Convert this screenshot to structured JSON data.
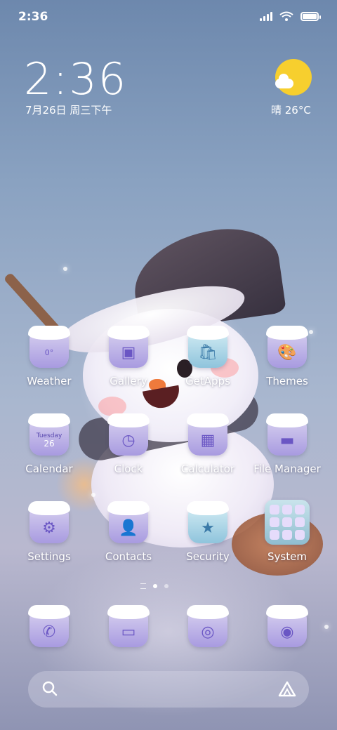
{
  "status_bar": {
    "time": "2:36",
    "icons": [
      "signal-icon",
      "wifi-icon",
      "battery-icon"
    ]
  },
  "clock_widget": {
    "time": "2:36",
    "date": "7月26日 周三下午"
  },
  "weather_widget": {
    "icon": "sunny-cloud-icon",
    "text": "晴 26°C"
  },
  "apps": [
    {
      "label": "Weather",
      "icon": "weather-icon",
      "glyph": "0°"
    },
    {
      "label": "Gallery",
      "icon": "gallery-icon",
      "glyph": "▣"
    },
    {
      "label": "GetApps",
      "icon": "getapps-icon",
      "glyph": "🛍"
    },
    {
      "label": "Themes",
      "icon": "themes-icon",
      "glyph": "🎨"
    },
    {
      "label": "Calendar",
      "icon": "calendar-icon",
      "glyph": "26",
      "sub": "Tuesday"
    },
    {
      "label": "Clock",
      "icon": "clock-icon",
      "glyph": "◷"
    },
    {
      "label": "Calculator",
      "icon": "calculator-icon",
      "glyph": "▦"
    },
    {
      "label": "File Manager",
      "icon": "folder-icon",
      "glyph": "▬"
    },
    {
      "label": "Settings",
      "icon": "settings-gear-icon",
      "glyph": "⚙"
    },
    {
      "label": "Contacts",
      "icon": "contacts-icon",
      "glyph": "👤"
    },
    {
      "label": "Security",
      "icon": "security-shield-icon",
      "glyph": "★"
    },
    {
      "label": "System",
      "icon": "system-folder-icon",
      "glyph": ""
    }
  ],
  "dock": [
    {
      "icon": "phone-icon",
      "glyph": "✆"
    },
    {
      "icon": "messages-icon",
      "glyph": "▭"
    },
    {
      "icon": "browser-icon",
      "glyph": "◎"
    },
    {
      "icon": "camera-icon",
      "glyph": "◉"
    }
  ],
  "colors": {
    "icon_purple": "#a89be0",
    "accent_purple": "#6a56c4",
    "sun_yellow": "#f7cf2e"
  }
}
